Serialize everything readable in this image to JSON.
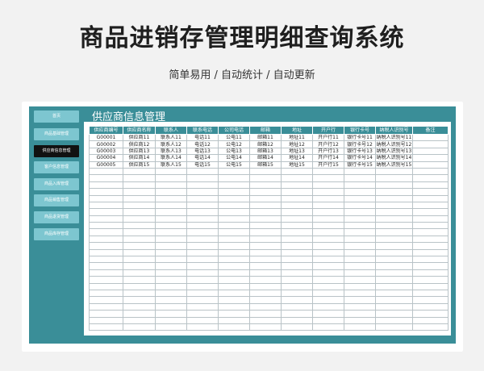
{
  "header": {
    "title": "商品进销存管理明细查询系统",
    "subtitle": "简单易用 / 自动统计 / 自动更新"
  },
  "sidebar": {
    "items": [
      {
        "label": "首页",
        "active": false
      },
      {
        "label": "商品基础管理",
        "active": false
      },
      {
        "label": "供应商信息管理",
        "active": true
      },
      {
        "label": "客户信息管理",
        "active": false
      },
      {
        "label": "商品入库管理",
        "active": false
      },
      {
        "label": "商品销售管理",
        "active": false
      },
      {
        "label": "商品退货管理",
        "active": false
      },
      {
        "label": "商品库存管理",
        "active": false
      }
    ]
  },
  "panel": {
    "title": "供应商信息管理"
  },
  "table": {
    "columns": [
      "供应商编号",
      "供应商名称",
      "联系人",
      "联系电话",
      "公司电话",
      "邮箱",
      "地址",
      "开户行",
      "银行卡号",
      "纳税人识别号",
      "备注"
    ],
    "rows": [
      [
        "G00001",
        "供应商11",
        "联系人11",
        "电话11",
        "公电11",
        "邮箱11",
        "地址11",
        "开户行11",
        "银行卡号11",
        "纳税人识别号11",
        ""
      ],
      [
        "G00002",
        "供应商12",
        "联系人12",
        "电话12",
        "公电12",
        "邮箱12",
        "地址12",
        "开户行12",
        "银行卡号12",
        "纳税人识别号12",
        ""
      ],
      [
        "G00003",
        "供应商13",
        "联系人13",
        "电话13",
        "公电13",
        "邮箱13",
        "地址13",
        "开户行13",
        "银行卡号13",
        "纳税人识别号13",
        ""
      ],
      [
        "G00004",
        "供应商14",
        "联系人14",
        "电话14",
        "公电14",
        "邮箱14",
        "地址14",
        "开户行14",
        "银行卡号14",
        "纳税人识别号14",
        ""
      ],
      [
        "G00005",
        "供应商15",
        "联系人15",
        "电话15",
        "公电15",
        "邮箱15",
        "地址15",
        "开户行15",
        "银行卡号15",
        "纳税人识别号15",
        ""
      ]
    ],
    "empty_rows": 24
  }
}
